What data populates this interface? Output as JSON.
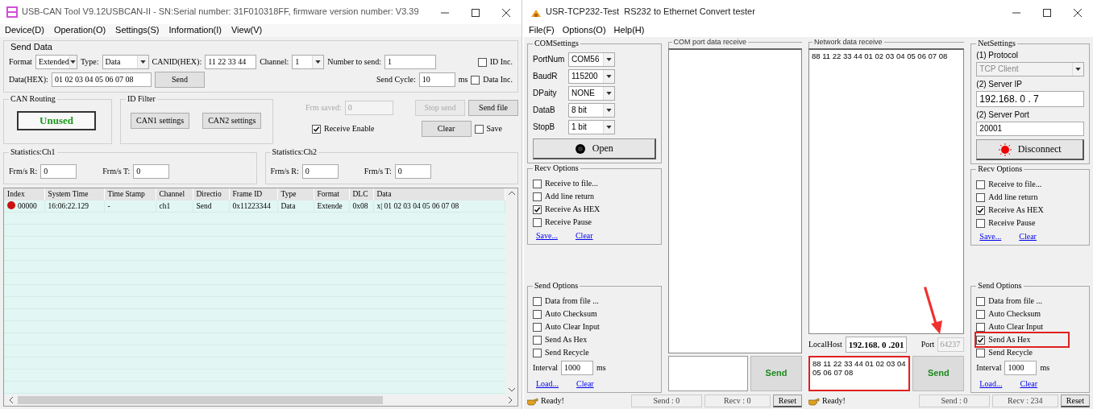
{
  "can_tool": {
    "title": "USB-CAN Tool V9.12USBCAN-II - SN:Serial number: 31F010318FF, firmware version number: V3.39",
    "menu": [
      "Device(D)",
      "Operation(O)",
      "Settings(S)",
      "Information(I)",
      "View(V)"
    ],
    "send_data": {
      "title": "Send Data",
      "format_label": "Format",
      "format": "Extended",
      "type_label": "Type:",
      "type": "Data",
      "canid_label": "CANID(HEX):",
      "canid": "11 22 33 44",
      "channel_label": "Channel:",
      "channel": "1",
      "number_label": "Number to send:",
      "number": "1",
      "id_inc": {
        "label": "ID Inc.",
        "checked": false
      },
      "data_label": "Data(HEX):",
      "data": "01 02 03 04 05 06 07 08",
      "send_button": "Send",
      "cycle_label": "Send Cycle:",
      "cycle": "10",
      "cycle_unit": "ms",
      "data_inc": {
        "label": "Data Inc.",
        "checked": false
      }
    },
    "can_routing": {
      "title": "CAN Routing",
      "status": "Unused"
    },
    "id_filter": {
      "title": "ID Filter",
      "buttons": [
        "CAN1 settings",
        "CAN2 settings"
      ]
    },
    "frames_saved": {
      "label": "Frm saved:",
      "value": "0",
      "disabled": true
    },
    "stop_send": {
      "label": "Stop send",
      "disabled": true
    },
    "send_file": {
      "label": "Send file",
      "disabled": false
    },
    "receive_enable": {
      "label": "Receive Enable",
      "checked": true
    },
    "clear_button": "Clear",
    "save": {
      "label": "Save",
      "checked": false
    },
    "statistics": [
      {
        "title": "Statistics:Ch1",
        "rx_label": "Frm/s R:",
        "rx": "0",
        "tx_label": "Frm/s T:",
        "tx": "0"
      },
      {
        "title": "Statistics:Ch2",
        "rx_label": "Frm/s R:",
        "rx": "0",
        "tx_label": "Frm/s T:",
        "tx": "0"
      }
    ],
    "table": {
      "columns": [
        "Index",
        "System Time",
        "Time Stamp",
        "Channel",
        "Directio",
        "Frame ID",
        "Type",
        "Format",
        "DLC",
        "Data"
      ],
      "rows": [
        {
          "color": "#cc1111",
          "cells": [
            "00000",
            "16:06:22.129",
            "-",
            "ch1",
            "Send",
            "0x11223344",
            "Data",
            "Extende",
            "0x08",
            "x| 01 02 03 04 05 06 07 08"
          ]
        }
      ]
    }
  },
  "tcp_tester": {
    "title": "USR-TCP232-Test  RS232 to Ethernet Convert tester",
    "menu": [
      "File(F)",
      "Options(O)",
      "Help(H)"
    ],
    "com_settings": {
      "title": "COMSettings",
      "fields": [
        {
          "label": "PortNum",
          "value": "COM56"
        },
        {
          "label": "BaudR",
          "value": "115200"
        },
        {
          "label": "DPaity",
          "value": "NONE"
        },
        {
          "label": "DataB",
          "value": "8 bit"
        },
        {
          "label": "StopB",
          "value": "1 bit"
        }
      ],
      "open_button": "Open"
    },
    "com_recv_options": {
      "title": "Recv Options",
      "options": [
        {
          "label": "Receive to file...",
          "checked": false
        },
        {
          "label": "Add line return",
          "checked": false
        },
        {
          "label": "Receive As HEX",
          "checked": true
        },
        {
          "label": "Receive Pause",
          "checked": false
        }
      ],
      "links": [
        "Save...",
        "Clear"
      ]
    },
    "com_send_options": {
      "title": "Send Options",
      "options": [
        {
          "label": "Data from file ...",
          "checked": false
        },
        {
          "label": "Auto Checksum",
          "checked": false
        },
        {
          "label": "Auto Clear Input",
          "checked": false
        },
        {
          "label": "Send As Hex",
          "checked": false
        },
        {
          "label": "Send Recycle",
          "checked": false
        }
      ],
      "interval_label": "Interval",
      "interval": "1000",
      "interval_unit": "ms",
      "links": [
        "Load...",
        "Clear"
      ]
    },
    "com_receive": {
      "title": "COM port data receive"
    },
    "com_send": {
      "button": "Send",
      "highlighted": false
    },
    "com_status": {
      "text": "Ready!",
      "send": "Send : 0",
      "recv": "Recv : 0",
      "reset": "Reset"
    },
    "net_receive": {
      "title": "Network data receive",
      "text": "88 11 22 33 44 01 02 03 04 05 06 07 08"
    },
    "local_host": {
      "label": "LocalHost",
      "value": "192.168. 0 .201",
      "port_label": "Port",
      "port": "64237"
    },
    "net_send": {
      "text": "88 11 22 33 44 01 02 03 04 05 06 07 08",
      "button": "Send",
      "highlighted": true
    },
    "net_settings": {
      "title": "NetSettings",
      "protocol_label": "(1) Protocol",
      "protocol": "TCP Client",
      "protocol_disabled": true,
      "ip_label": "(2) Server IP",
      "ip": "192.168. 0 . 7",
      "port_label": "(2) Server Port",
      "port": "20001",
      "button": "Disconnect"
    },
    "net_recv_options": {
      "title": "Recv Options",
      "options": [
        {
          "label": "Receive to file...",
          "checked": false
        },
        {
          "label": "Add line return",
          "checked": false
        },
        {
          "label": "Receive As HEX",
          "checked": true
        },
        {
          "label": "Receive Pause",
          "checked": false
        }
      ],
      "links": [
        "Save...",
        "Clear"
      ]
    },
    "net_send_options": {
      "title": "Send Options",
      "options": [
        {
          "label": "Data from file ...",
          "checked": false,
          "highlighted": false
        },
        {
          "label": "Auto Checksum",
          "checked": false,
          "highlighted": false
        },
        {
          "label": "Auto Clear Input",
          "checked": false,
          "highlighted": false
        },
        {
          "label": "Send As Hex",
          "checked": true,
          "highlighted": true
        },
        {
          "label": "Send Recycle",
          "checked": false,
          "highlighted": false
        }
      ],
      "interval_label": "Interval",
      "interval": "1000",
      "interval_unit": "ms",
      "links": [
        "Load...",
        "Clear"
      ]
    },
    "net_status": {
      "text": "Ready!",
      "send": "Send : 0",
      "recv": "Recv : 234",
      "reset": "Reset"
    }
  }
}
